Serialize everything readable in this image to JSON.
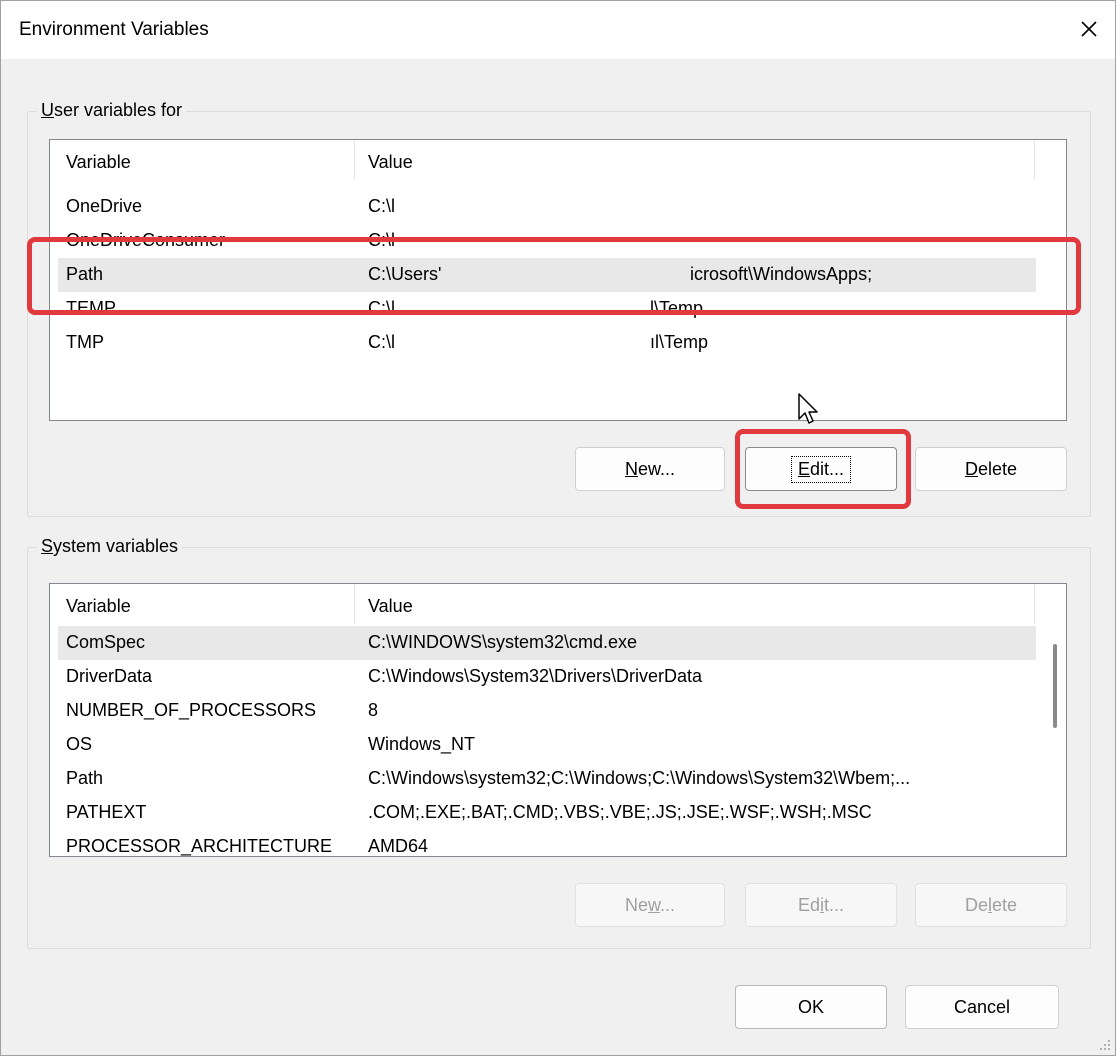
{
  "window": {
    "title": "Environment Variables",
    "close_icon": "close-icon"
  },
  "user_group": {
    "label_mnemonic": "U",
    "label_rest": "ser variables for",
    "columns": [
      "Variable",
      "Value"
    ],
    "rows": [
      {
        "variable": "OneDrive",
        "value": "C:\\l"
      },
      {
        "variable": "OneDriveConsumer",
        "value": "C:\\l"
      },
      {
        "variable": "Path",
        "value": "C:\\Users'",
        "value_tail": "icrosoft\\WindowsApps;"
      },
      {
        "variable": "TEMP",
        "value": "C:\\l",
        "value_tail": "l\\Temp"
      },
      {
        "variable": "TMP",
        "value": "C:\\l",
        "value_tail": "ıl\\Temp"
      }
    ],
    "selected_row": "Path",
    "buttons": {
      "new_m": "N",
      "new_rest": "ew...",
      "edit_m": "E",
      "edit_rest": "dit...",
      "delete_m": "D",
      "delete_rest": "elete"
    }
  },
  "system_group": {
    "label_mnemonic": "S",
    "label_rest": "ystem variables",
    "columns": [
      "Variable",
      "Value"
    ],
    "rows": [
      {
        "variable": "ComSpec",
        "value": "C:\\WINDOWS\\system32\\cmd.exe"
      },
      {
        "variable": "DriverData",
        "value": "C:\\Windows\\System32\\Drivers\\DriverData"
      },
      {
        "variable": "NUMBER_OF_PROCESSORS",
        "value": "8"
      },
      {
        "variable": "OS",
        "value": "Windows_NT"
      },
      {
        "variable": "Path",
        "value": "C:\\Windows\\system32;C:\\Windows;C:\\Windows\\System32\\Wbem;..."
      },
      {
        "variable": "PATHEXT",
        "value": ".COM;.EXE;.BAT;.CMD;.VBS;.VBE;.JS;.JSE;.WSF;.WSH;.MSC"
      },
      {
        "variable": "PROCESSOR_ARCHITECTURE",
        "value": "AMD64"
      }
    ],
    "selected_row": "ComSpec",
    "buttons": {
      "new_pre": "Ne",
      "new_m": "w",
      "new_post": "...",
      "edit_pre": "Ed",
      "edit_m": "i",
      "edit_post": "t...",
      "delete_pre": "De",
      "delete_m": "l",
      "delete_post": "ete"
    }
  },
  "footer": {
    "ok": "OK",
    "cancel": "Cancel"
  },
  "colors": {
    "highlight": "#e0393e",
    "dialog_bg": "#f0f0f0"
  }
}
